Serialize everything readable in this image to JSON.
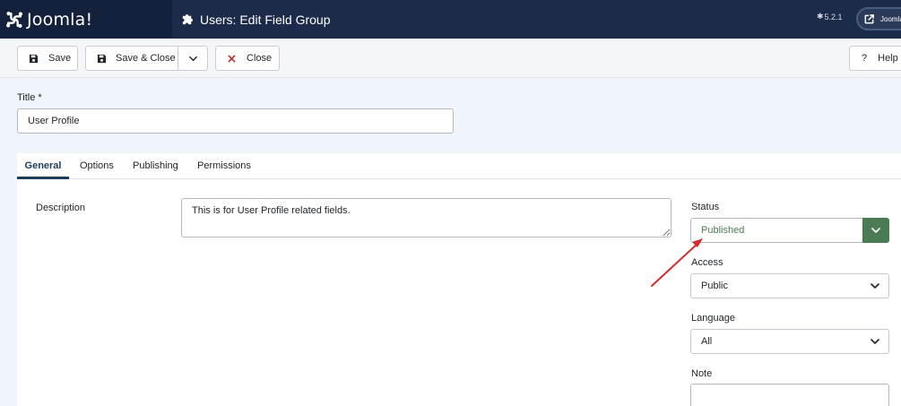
{
  "header": {
    "logo_text": "Joomla!",
    "page_title": "Users: Edit Field Group",
    "title_icon": "puzzle-icon",
    "version": "5.2.1",
    "site_link_label": "Joomla"
  },
  "toolbar": {
    "save_label": "Save",
    "save_close_label": "Save & Close",
    "close_label": "Close",
    "help_label": "Help"
  },
  "form": {
    "title_label": "Title *",
    "title_value": "User Profile"
  },
  "tabs": [
    {
      "label": "General",
      "active": true
    },
    {
      "label": "Options",
      "active": false
    },
    {
      "label": "Publishing",
      "active": false
    },
    {
      "label": "Permissions",
      "active": false
    }
  ],
  "general": {
    "description_label": "Description",
    "description_value": "This is for User Profile related fields.",
    "status_label": "Status",
    "status_value": "Published",
    "access_label": "Access",
    "access_value": "Public",
    "language_label": "Language",
    "language_value": "All",
    "note_label": "Note",
    "note_value": ""
  },
  "colors": {
    "header_bg": "#1c2b4a",
    "status_accent": "#4b7b52",
    "close_icon": "#c52827",
    "annotation_arrow": "#d22b2b"
  }
}
